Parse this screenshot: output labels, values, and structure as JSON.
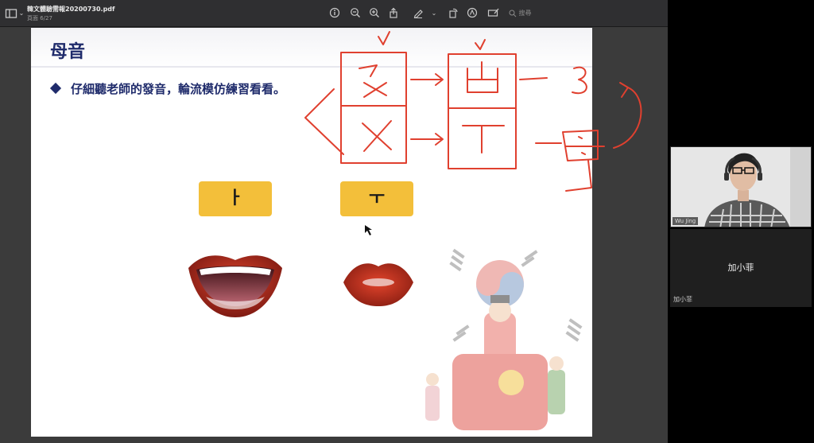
{
  "toolbar": {
    "doc_title": "韓文體驗需報20200730.pdf",
    "doc_subtitle": "頁面 6/27",
    "search_placeholder": "搜尋"
  },
  "slide": {
    "title": "母音",
    "instruction": "仔細聽老師的發音，輪流模仿練習看看。",
    "vowels": [
      "ㅏ",
      "ㅜ"
    ]
  },
  "annotations": {
    "boxes": [
      "ㄡ",
      "ㄨ",
      "ㅂ",
      "ㅜ"
    ],
    "side_marks": [
      "3",
      "母"
    ]
  },
  "participants": {
    "camera_label": "Wu Jing",
    "name_center": "加小菲",
    "name_corner": "加小菲"
  },
  "colors": {
    "title_navy": "#1f2b6b",
    "vowel_box": "#f3bf3a",
    "ink_red": "#e0402f"
  }
}
